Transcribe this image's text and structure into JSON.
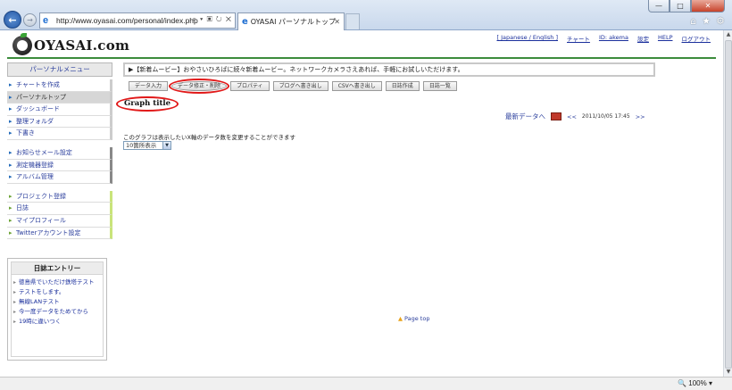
{
  "browser": {
    "url": "http://www.oyasai.com/personal/index.php",
    "tab_title": "OYASAI パーソナルトップ",
    "zoom": "100%"
  },
  "header": {
    "logo_text": "OYASAI.com",
    "links": [
      "[ Japanese / English ]",
      "チャート",
      "ID: akema",
      "設定",
      "HELP",
      "ログアウト"
    ]
  },
  "sidebar": {
    "title": "パーソナルメニュー",
    "group1": [
      "チャートを作成",
      "パーソナルトップ",
      "ダッシュボード",
      "整理フォルダ",
      "下書き"
    ],
    "group2": [
      "お知らせメール設定",
      "測定機器登録",
      "アルバム管理"
    ],
    "group3": [
      "プロジェクト登録",
      "日誌",
      "マイプロフィール",
      "Twitterアカウント設定"
    ],
    "active_index": 1,
    "diary": {
      "title": "日誌エントリー",
      "entries": [
        "徳島県でいただけ鉄塔テスト",
        "テストをします。",
        "無線LANテスト",
        "今一度データをためてから",
        "19時に違いつく"
      ]
    }
  },
  "main": {
    "news": "▶【新着ムービー】おやさいひろばに続々新着ムービー。ネットワークカメラさえあれば、手軽にお試しいただけます。",
    "tabs": [
      "データ入力",
      "データ修正・削除",
      "プロパティ",
      "ブログへ書き出し",
      "CSVへ書き出し",
      "日誌作成",
      "日誌一覧"
    ],
    "circled_tab": 1,
    "graph_title": "Graph title",
    "latest_label": "最新データへ",
    "prev": "<<",
    "next": ">>",
    "timestamp": "2011/10/05 17:45",
    "description": "このグラフは表示したいX軸のデータ数を変更することができます",
    "select_value": "10箇所表示",
    "page_top": "Page top"
  },
  "colors": {
    "accent_green": "#3c8c3c",
    "link_blue": "#2a3e9c",
    "highlight_red": "#e11919"
  }
}
